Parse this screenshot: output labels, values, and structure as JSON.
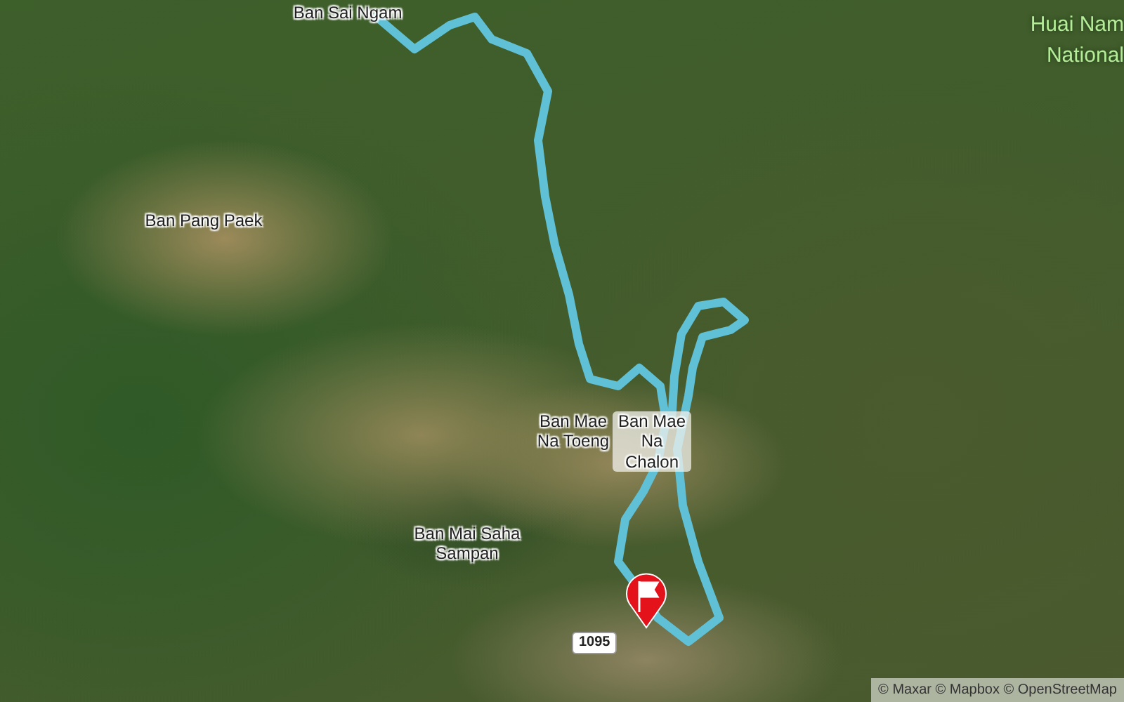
{
  "map": {
    "labels": [
      {
        "kind": "place",
        "text": "Ban Sai Ngam"
      },
      {
        "kind": "place",
        "text": "Ban Pang Paek"
      },
      {
        "kind": "place",
        "text": "Ban Mae Na Toeng"
      },
      {
        "kind": "place",
        "text": "Ban Mae Na Chalon"
      },
      {
        "kind": "place",
        "text": "Ban Mai Saha Sampan"
      },
      {
        "kind": "park",
        "text": "Huai Nam"
      },
      {
        "kind": "park",
        "text": "National"
      }
    ],
    "road_shield": "1095",
    "attribution": "© Maxar © Mapbox © OpenStreetMap"
  }
}
